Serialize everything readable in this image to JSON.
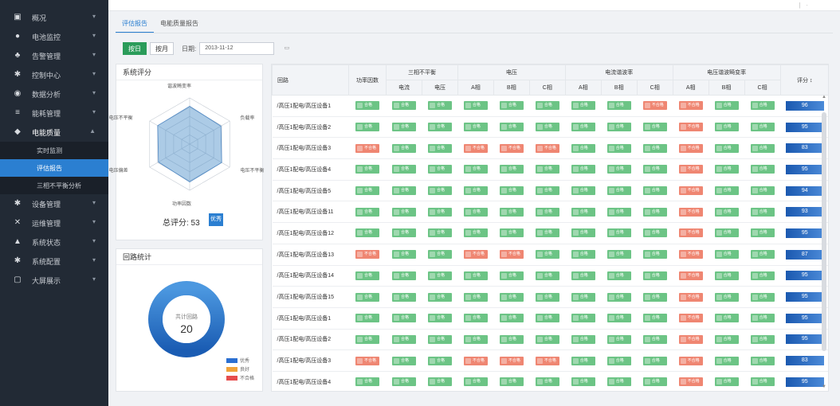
{
  "sidebar": {
    "items": [
      {
        "label": "概况",
        "icon": "monitor-icon"
      },
      {
        "label": "电池监控",
        "icon": "dot-icon"
      },
      {
        "label": "告警管理",
        "icon": "person-icon"
      },
      {
        "label": "控制中心",
        "icon": "gear-icon"
      },
      {
        "label": "数据分析",
        "icon": "globe-icon"
      },
      {
        "label": "能耗管理",
        "icon": "bars-icon"
      },
      {
        "label": "电能质量",
        "icon": "shield-icon",
        "open": true
      }
    ],
    "sub_items": [
      {
        "label": "实时监测",
        "active": false
      },
      {
        "label": "评估报告",
        "active": true
      },
      {
        "label": "三相不平衡分析",
        "active": false
      }
    ],
    "items_after": [
      {
        "label": "设备管理",
        "icon": "gear-icon"
      },
      {
        "label": "运维管理",
        "icon": "tools-icon"
      },
      {
        "label": "系统状态",
        "icon": "chart-icon"
      },
      {
        "label": "系统配置",
        "icon": "gear-icon"
      },
      {
        "label": "大屏展示",
        "icon": "screen-icon"
      }
    ]
  },
  "tabs": [
    "评估报告",
    "电能质量报告"
  ],
  "filter": {
    "day_btn": "按日",
    "month_btn": "按月",
    "date_label": "日期:",
    "date_value": "2013-11-12"
  },
  "radar_panel": {
    "title": "系统评分",
    "labels": [
      "谐波畸变率",
      "负载率",
      "电压不平衡",
      "功率因数",
      "电压偏差",
      "电压不平衡"
    ],
    "values": [
      0.82,
      0.78,
      0.8,
      0.82,
      0.78,
      0.8
    ],
    "score_label": "总评分: 53",
    "grade": "优秀"
  },
  "stat_panel": {
    "title": "回路统计",
    "center_label": "共计回路",
    "center_value": "20",
    "legend": [
      {
        "label": "优秀",
        "color": "#2b6fd1"
      },
      {
        "label": "良好",
        "color": "#f0a33a"
      },
      {
        "label": "不合格",
        "color": "#e64d4d"
      }
    ],
    "shares": [
      1.0,
      0.0,
      0.0
    ]
  },
  "table": {
    "headers": {
      "device": "回路",
      "pf": "功率因数",
      "three_phase": "三相不平衡",
      "voltage": "电压",
      "current_harmonic": "电流谐波率",
      "voltage_harmonic": "电压谐波畸变率",
      "score": "评分 ↕",
      "sub": [
        "电流",
        "电压",
        "A相",
        "B相",
        "C相",
        "A相",
        "B相",
        "C相",
        "A相",
        "B相",
        "C相"
      ]
    },
    "ok_label": "合格",
    "bad_label": "不合格",
    "rows": [
      {
        "name": "/高压1配电/高压设备1",
        "cells": [
          1,
          1,
          1,
          1,
          1,
          1,
          1,
          1,
          0,
          0,
          1,
          1
        ],
        "score": "96"
      },
      {
        "name": "/高压1配电/高压设备2",
        "cells": [
          1,
          1,
          1,
          1,
          1,
          1,
          1,
          1,
          1,
          0,
          1,
          1
        ],
        "score": "95"
      },
      {
        "name": "/高压1配电/高压设备3",
        "cells": [
          0,
          1,
          1,
          0,
          0,
          0,
          1,
          1,
          1,
          0,
          1,
          1
        ],
        "score": "83"
      },
      {
        "name": "/高压1配电/高压设备4",
        "cells": [
          1,
          1,
          1,
          1,
          1,
          1,
          1,
          1,
          1,
          0,
          1,
          1
        ],
        "score": "95"
      },
      {
        "name": "/高压1配电/高压设备5",
        "cells": [
          1,
          1,
          1,
          1,
          1,
          1,
          1,
          1,
          1,
          0,
          1,
          1
        ],
        "score": "94"
      },
      {
        "name": "/高压1配电/高压设备11",
        "cells": [
          1,
          1,
          1,
          1,
          1,
          1,
          1,
          1,
          1,
          0,
          1,
          1
        ],
        "score": "93"
      },
      {
        "name": "/高压1配电/高压设备12",
        "cells": [
          1,
          1,
          1,
          1,
          1,
          1,
          1,
          1,
          1,
          0,
          1,
          1
        ],
        "score": "95"
      },
      {
        "name": "/高压1配电/高压设备13",
        "cells": [
          0,
          1,
          1,
          0,
          0,
          1,
          1,
          1,
          1,
          0,
          1,
          1
        ],
        "score": "87"
      },
      {
        "name": "/高压1配电/高压设备14",
        "cells": [
          1,
          1,
          1,
          1,
          1,
          1,
          1,
          1,
          1,
          0,
          1,
          1
        ],
        "score": "95"
      },
      {
        "name": "/高压1配电/高压设备15",
        "cells": [
          1,
          1,
          1,
          1,
          1,
          1,
          1,
          1,
          1,
          0,
          1,
          1
        ],
        "score": "95"
      },
      {
        "name": "/高压1配电/高压设备1",
        "cells": [
          1,
          1,
          1,
          1,
          1,
          1,
          1,
          1,
          1,
          0,
          1,
          1
        ],
        "score": "95"
      },
      {
        "name": "/高压1配电/高压设备2",
        "cells": [
          1,
          1,
          1,
          1,
          1,
          1,
          1,
          1,
          1,
          0,
          1,
          1
        ],
        "score": "95"
      },
      {
        "name": "/高压1配电/高压设备3",
        "cells": [
          0,
          1,
          1,
          0,
          0,
          0,
          1,
          1,
          1,
          0,
          1,
          1
        ],
        "score": "83"
      },
      {
        "name": "/高压1配电/高压设备4",
        "cells": [
          1,
          1,
          1,
          1,
          1,
          1,
          1,
          1,
          1,
          0,
          1,
          1
        ],
        "score": "95"
      }
    ]
  }
}
